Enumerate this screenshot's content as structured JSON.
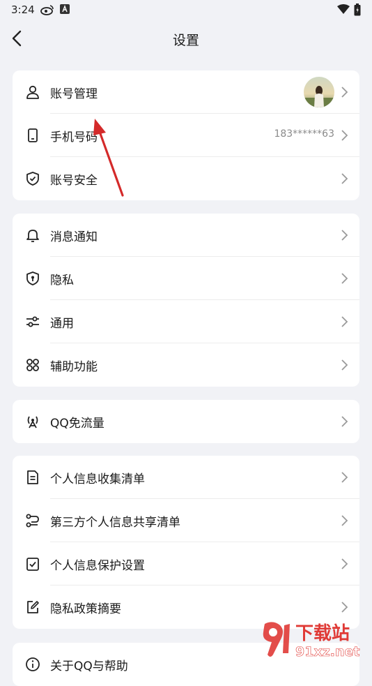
{
  "status_bar": {
    "time": "3:24"
  },
  "header": {
    "title": "设置"
  },
  "groups": [
    {
      "items": [
        {
          "label": "账号管理",
          "icon": "person-icon",
          "has_avatar": true
        },
        {
          "label": "手机号码",
          "icon": "phone-icon",
          "value": "183******63"
        },
        {
          "label": "账号安全",
          "icon": "shield-check-icon"
        }
      ]
    },
    {
      "items": [
        {
          "label": "消息通知",
          "icon": "bell-icon"
        },
        {
          "label": "隐私",
          "icon": "privacy-shield-icon"
        },
        {
          "label": "通用",
          "icon": "sliders-icon"
        },
        {
          "label": "辅助功能",
          "icon": "grid-icon"
        }
      ]
    },
    {
      "items": [
        {
          "label": "QQ免流量",
          "icon": "signal-tower-icon"
        }
      ]
    },
    {
      "items": [
        {
          "label": "个人信息收集清单",
          "icon": "document-icon"
        },
        {
          "label": "第三方个人信息共享清单",
          "icon": "share-flow-icon"
        },
        {
          "label": "个人信息保护设置",
          "icon": "clipboard-check-icon"
        },
        {
          "label": "隐私政策摘要",
          "icon": "edit-icon"
        }
      ]
    },
    {
      "items": [
        {
          "label": "关于QQ与帮助",
          "icon": "info-icon"
        }
      ]
    }
  ],
  "watermark": {
    "brand": "下载站",
    "url": "91xz.net"
  },
  "colors": {
    "background": "#f1f2f6",
    "card": "#ffffff",
    "annotation_arrow": "#d42a2a",
    "watermark_red": "#e03a36"
  }
}
